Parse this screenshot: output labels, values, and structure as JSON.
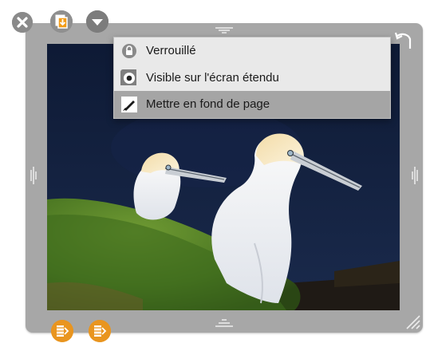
{
  "window": {
    "toolbar": {
      "close": "close-icon",
      "widget": "widget-icon",
      "dropdown": "chevron-down-icon"
    },
    "rotate_icon": "rotate-icon",
    "resize_icon": "resize-grip-icon"
  },
  "menu": {
    "items": [
      {
        "label": "Verrouillé",
        "icon": "lock-icon",
        "highlighted": false
      },
      {
        "label": "Visible sur l'écran étendu",
        "icon": "eye-icon",
        "highlighted": false
      },
      {
        "label": "Mettre en fond de page",
        "icon": "brush-icon",
        "highlighted": true
      }
    ]
  },
  "bottom_buttons": [
    {
      "icon": "layer-icon"
    },
    {
      "icon": "layer-icon"
    }
  ],
  "colors": {
    "frame": "#a7a7a7",
    "menu_bg": "#e9e9e9",
    "menu_highlight": "#a5a5a5",
    "bottom_button": "#e9951f",
    "widget_accent": "#f39c18"
  }
}
